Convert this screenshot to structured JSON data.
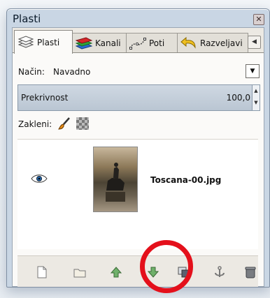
{
  "window": {
    "title": "Plasti",
    "close_icon": "close-icon"
  },
  "tabs": [
    {
      "label": "Plasti",
      "icon": "layers-icon",
      "active": true
    },
    {
      "label": "Kanali",
      "icon": "channels-icon",
      "active": false
    },
    {
      "label": "Poti",
      "icon": "paths-icon",
      "active": false
    },
    {
      "label": "Razveljavi",
      "icon": "undo-icon",
      "active": false
    }
  ],
  "tabs_menu_icon": "tab-menu-icon",
  "mode": {
    "label": "Način:",
    "value": "Navadno"
  },
  "opacity": {
    "label": "Prekrivnost",
    "value": "100,0"
  },
  "lock": {
    "label": "Zakleni:",
    "icons": [
      "brush-icon",
      "checkerboard-icon"
    ]
  },
  "layers": [
    {
      "name": "Toscana-00.jpg",
      "visible": true
    }
  ],
  "bottom_buttons": [
    "new-layer-icon",
    "new-layer-group-icon",
    "raise-layer-icon",
    "lower-layer-icon",
    "duplicate-layer-icon",
    "anchor-layer-icon",
    "delete-layer-icon"
  ],
  "colors": {
    "highlight_circle": "#e4101b",
    "accent": "#c9d6e4"
  }
}
